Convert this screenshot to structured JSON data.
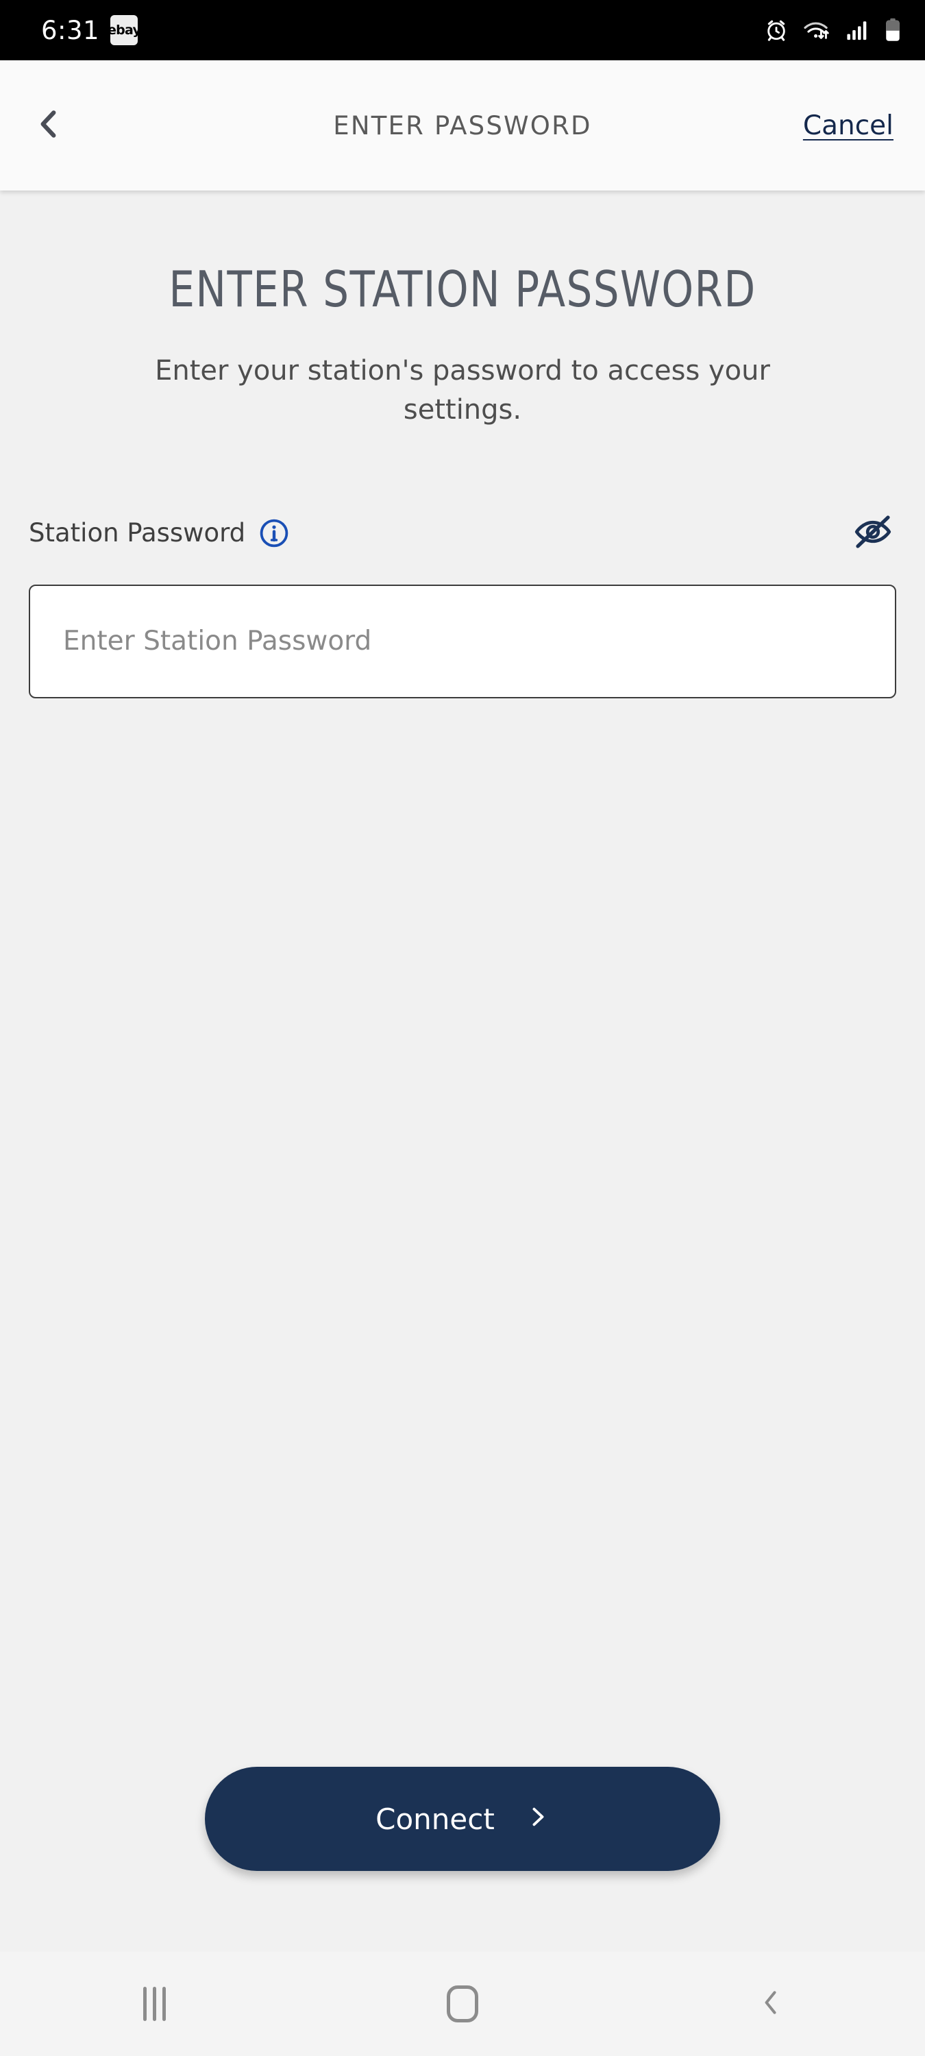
{
  "status_bar": {
    "clock": "6:31",
    "notification_badge": "ebay",
    "icons": [
      "alarm-icon",
      "wifi-icon",
      "signal-icon",
      "battery-icon"
    ],
    "background": "#000000"
  },
  "header": {
    "back_icon": "chevron-left-icon",
    "title": "ENTER PASSWORD",
    "cancel_label": "Cancel",
    "cancel_color": "#14284c",
    "background": "#fafafa"
  },
  "main": {
    "title": "ENTER STATION PASSWORD",
    "subtitle": "Enter your station's password to access your settings.",
    "field": {
      "label": "Station Password",
      "info_icon": "info-circle-icon",
      "info_icon_color": "#1a4fb5",
      "visibility_icon": "eye-off-icon",
      "visibility_icon_color": "#1c3255",
      "value": "",
      "placeholder": "Enter Station Password"
    },
    "primary_button": {
      "label": "Connect",
      "icon": "chevron-right-icon",
      "background": "#1b3254",
      "text_color": "#ffffff"
    },
    "background": "#f1f1f1"
  },
  "nav_bar": {
    "recents_icon": "recents-icon",
    "home_icon": "home-icon",
    "back_icon": "chevron-left-icon",
    "background": "#f4f4f4"
  }
}
